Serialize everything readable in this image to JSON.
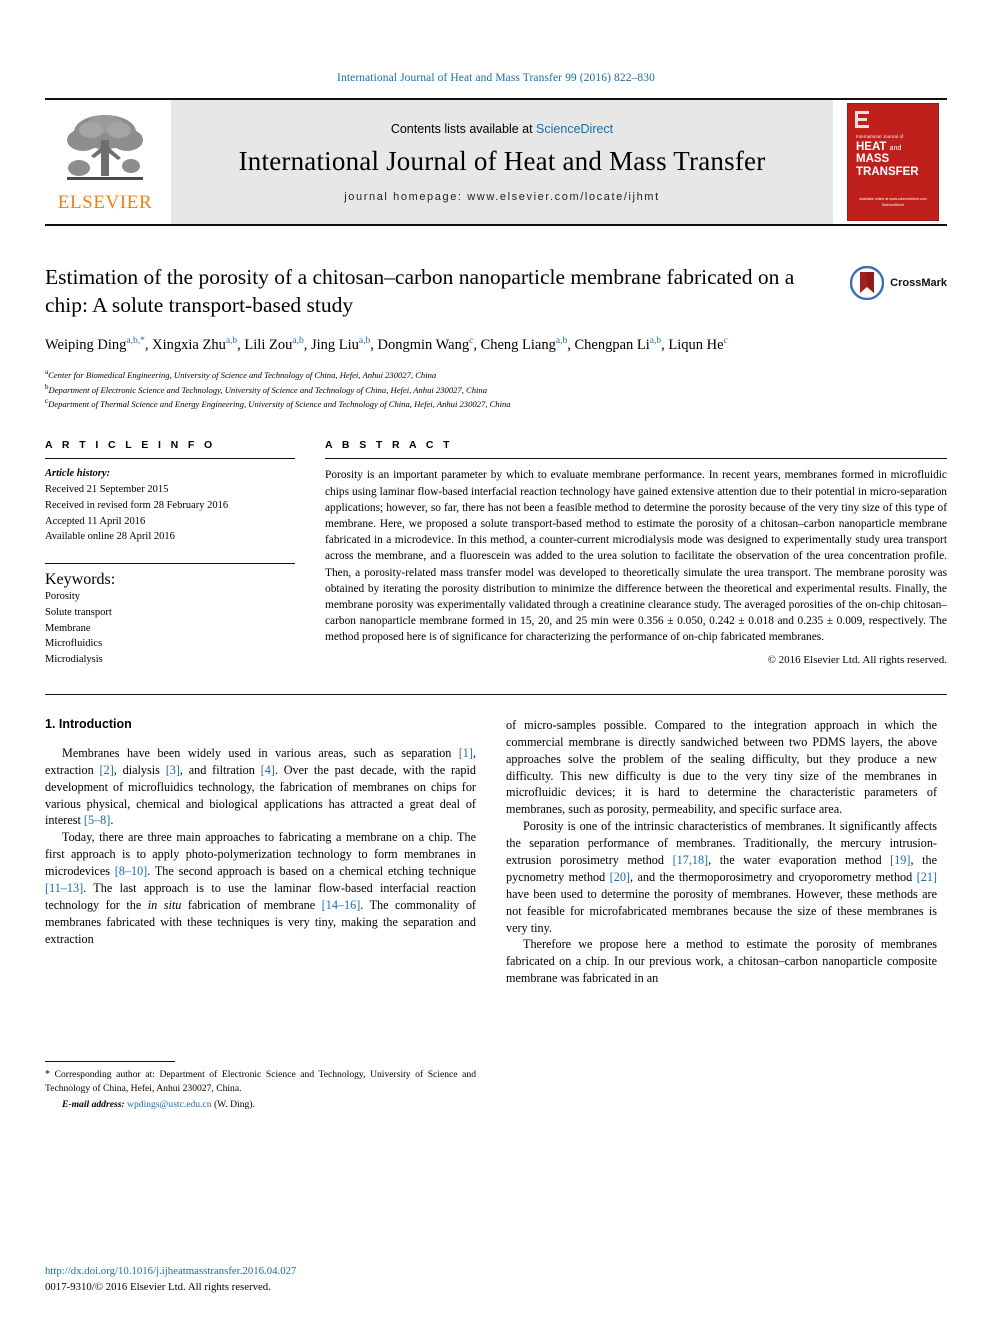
{
  "running_head": "International Journal of Heat and Mass Transfer 99 (2016) 822–830",
  "masthead": {
    "publisher_name": "ELSEVIER",
    "contents_prefix": "Contents lists available at ",
    "contents_link": "ScienceDirect",
    "journal_title": "International Journal of Heat and Mass Transfer",
    "homepage": "journal homepage: www.elsevier.com/locate/ijhmt",
    "cover": {
      "small_line": "International Journal of",
      "big_line_1": "HEAT",
      "big_and": "and",
      "big_line_2": "MASS",
      "big_line_3": "TRANSFER",
      "foot_line_1": "Available online at www.sciencedirect.com",
      "foot_line_2": "ScienceDirect"
    }
  },
  "title": "Estimation of the porosity of a chitosan–carbon nanoparticle membrane fabricated on a chip: A solute transport-based study",
  "crossmark_label": "CrossMark",
  "authors": [
    {
      "name": "Weiping Ding",
      "sup": "a,b,*"
    },
    {
      "name": "Xingxia Zhu",
      "sup": "a,b"
    },
    {
      "name": "Lili Zou",
      "sup": "a,b"
    },
    {
      "name": "Jing Liu",
      "sup": "a,b"
    },
    {
      "name": "Dongmin Wang",
      "sup": "c"
    },
    {
      "name": "Cheng Liang",
      "sup": "a,b"
    },
    {
      "name": "Chengpan Li",
      "sup": "a,b"
    },
    {
      "name": "Liqun He",
      "sup": "c"
    }
  ],
  "affiliations": [
    {
      "mark": "a",
      "text": "Center for Biomedical Engineering, University of Science and Technology of China, Hefei, Anhui 230027, China"
    },
    {
      "mark": "b",
      "text": "Department of Electronic Science and Technology, University of Science and Technology of China, Hefei, Anhui 230027, China"
    },
    {
      "mark": "c",
      "text": "Department of Thermal Science and Energy Engineering, University of Science and Technology of China, Hefei, Anhui 230027, China"
    }
  ],
  "article_info": {
    "heading": "A R T I C L E   I N F O",
    "history_label": "Article history:",
    "history": [
      "Received 21 September 2015",
      "Received in revised form 28 February 2016",
      "Accepted 11 April 2016",
      "Available online 28 April 2016"
    ],
    "keywords_label": "Keywords:",
    "keywords": [
      "Porosity",
      "Solute transport",
      "Membrane",
      "Microfluidics",
      "Microdialysis"
    ]
  },
  "abstract": {
    "heading": "A B S T R A C T",
    "text": "Porosity is an important parameter by which to evaluate membrane performance. In recent years, membranes formed in microfluidic chips using laminar flow-based interfacial reaction technology have gained extensive attention due to their potential in micro-separation applications; however, so far, there has not been a feasible method to determine the porosity because of the very tiny size of this type of membrane. Here, we proposed a solute transport-based method to estimate the porosity of a chitosan–carbon nanoparticle membrane fabricated in a microdevice. In this method, a counter-current microdialysis mode was designed to experimentally study urea transport across the membrane, and a fluorescein was added to the urea solution to facilitate the observation of the urea concentration profile. Then, a porosity-related mass transfer model was developed to theoretically simulate the urea transport. The membrane porosity was obtained by iterating the porosity distribution to minimize the difference between the theoretical and experimental results. Finally, the membrane porosity was experimentally validated through a creatinine clearance study. The averaged porosities of the on-chip chitosan–carbon nanoparticle membrane formed in 15, 20, and 25 min were 0.356 ± 0.050, 0.242 ± 0.018 and 0.235 ± 0.009, respectively. The method proposed here is of significance for characterizing the performance of on-chip fabricated membranes.",
    "copyright": "© 2016 Elsevier Ltd. All rights reserved."
  },
  "body": {
    "section_title": "1. Introduction",
    "left_paragraphs": [
      {
        "parts": [
          {
            "t": "Membranes have been widely used in various areas, such as separation "
          },
          {
            "t": "[1]",
            "cite": true
          },
          {
            "t": ", extraction "
          },
          {
            "t": "[2]",
            "cite": true
          },
          {
            "t": ", dialysis "
          },
          {
            "t": "[3]",
            "cite": true
          },
          {
            "t": ", and filtration "
          },
          {
            "t": "[4]",
            "cite": true
          },
          {
            "t": ". Over the past decade, with the rapid development of microfluidics technology, the fabrication of membranes on chips for various physical, chemical and biological applications has attracted a great deal of interest "
          },
          {
            "t": "[5–8]",
            "cite": true
          },
          {
            "t": "."
          }
        ]
      },
      {
        "parts": [
          {
            "t": "Today, there are three main approaches to fabricating a membrane on a chip. The first approach is to apply photo-polymerization technology to form membranes in microdevices "
          },
          {
            "t": "[8–10]",
            "cite": true
          },
          {
            "t": ". The second approach is based on a chemical etching technique "
          },
          {
            "t": "[11–13]",
            "cite": true
          },
          {
            "t": ". The last approach is to use the laminar flow-based interfacial reaction technology for the "
          },
          {
            "t": "in situ",
            "italic": true
          },
          {
            "t": " fabrication of membrane "
          },
          {
            "t": "[14–16]",
            "cite": true
          },
          {
            "t": ". The commonality of membranes fabricated with these techniques is very tiny, making the separation and extraction"
          }
        ]
      }
    ],
    "right_paragraphs": [
      {
        "no_indent": true,
        "parts": [
          {
            "t": "of micro-samples possible. Compared to the integration approach in which the commercial membrane is directly sandwiched between two PDMS layers, the above approaches solve the problem of the sealing difficulty, but they produce a new difficulty. This new difficulty is due to the very tiny size of the membranes in microfluidic devices; it is hard to determine the characteristic parameters of membranes, such as porosity, permeability, and specific surface area."
          }
        ]
      },
      {
        "parts": [
          {
            "t": "Porosity is one of the intrinsic characteristics of membranes. It significantly affects the separation performance of membranes. Traditionally, the mercury intrusion-extrusion porosimetry method "
          },
          {
            "t": "[17,18]",
            "cite": true
          },
          {
            "t": ", the water evaporation method "
          },
          {
            "t": "[19]",
            "cite": true
          },
          {
            "t": ", the pycnometry method "
          },
          {
            "t": "[20]",
            "cite": true
          },
          {
            "t": ", and the thermoporosimetry and cryoporometry method "
          },
          {
            "t": "[21]",
            "cite": true
          },
          {
            "t": " have been used to determine the porosity of membranes. However, these methods are not feasible for microfabricated membranes because the size of these membranes is very tiny."
          }
        ]
      },
      {
        "parts": [
          {
            "t": "Therefore we propose here a method to estimate the porosity of membranes fabricated on a chip. In our previous work, a chitosan–carbon nanoparticle composite membrane was fabricated in an"
          }
        ]
      }
    ]
  },
  "footnotes": {
    "corresponding_star": "*",
    "corresponding_text": " Corresponding author at: Department of Electronic Science and Technology, University of Science and Technology of China, Hefei, Anhui 230027, China.",
    "email_label": "E-mail address:",
    "email": "wpdings@ustc.edu.cn",
    "email_suffix": " (W. Ding)."
  },
  "doi": {
    "url": "http://dx.doi.org/10.1016/j.ijheatmasstransfer.2016.04.027",
    "issn_line": "0017-9310/© 2016 Elsevier Ltd. All rights reserved."
  },
  "colors": {
    "link_blue": "#1b6ca8",
    "elsevier_orange": "#f07f13",
    "cover_red": "#c0201c"
  }
}
